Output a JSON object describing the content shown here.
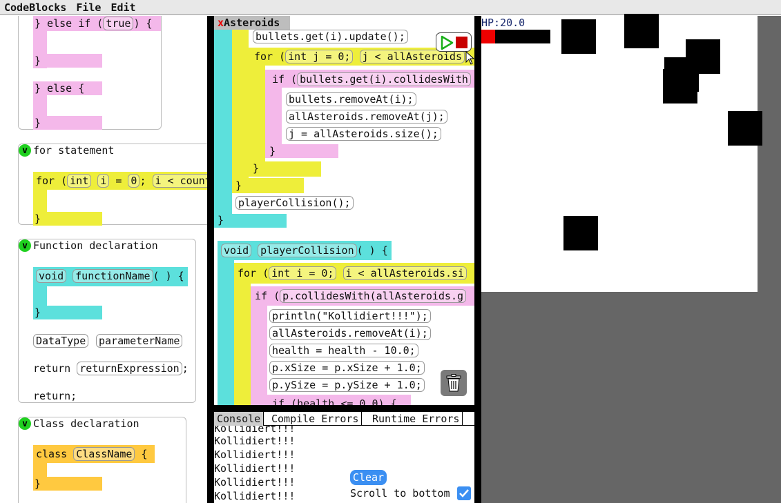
{
  "menubar": {
    "app": "CodeBlocks",
    "file": "File",
    "edit": "Edit"
  },
  "palette": {
    "elseif": {
      "keyword": "} else if (",
      "cond": "true",
      "tail": ") {",
      "close": "}"
    },
    "else": {
      "text": "} else {",
      "close": "}"
    },
    "for": {
      "title": "for statement",
      "kw": "for (",
      "int": "int",
      "var": "i",
      "eq": "= ",
      "zero": "0",
      "semi": ";",
      "cond": "i < count",
      "close": "}"
    },
    "func": {
      "title": "Function declaration",
      "void": "void",
      "name": "functionName",
      "paren": "( ) {",
      "close": "}",
      "datatype": "DataType",
      "param": "parameterName",
      "return_kw": "return",
      "return_expr": "returnExpression",
      "return_semi": ";",
      "return_only": "return;"
    },
    "class": {
      "title": "Class declaration",
      "kw": "class",
      "name": "ClassName",
      "brace": "{",
      "close": "}"
    },
    "v": "v"
  },
  "editor": {
    "tab_close": "x",
    "tab_title": "Asteroids",
    "lines": {
      "l1": "bullets.get(i).update();",
      "l2_kw": "for (",
      "l2_int": "int j = 0;",
      "l2_cond": "j < allAsteroids",
      "l3_kw": "if (",
      "l3_cond": "bullets.get(i).collidesWith",
      "l4": "bullets.removeAt(i);",
      "l5": "allAsteroids.removeAt(j);",
      "l6": "j = allAsteroids.size();",
      "c1": "}",
      "c2": "}",
      "c3": "}",
      "l7": "playerCollision();",
      "c4": "}",
      "f_void": "void",
      "f_name": "playerCollision",
      "f_paren": "( ) {",
      "f2_kw": "for (",
      "f2_int": "int i = 0;",
      "f2_cond": "i < allAsteroids.si",
      "f3_kw": "if (",
      "f3_cond": "p.collidesWith(allAsteroids.g",
      "f4": "println(\"Kollidiert!!!\");",
      "f5": "allAsteroids.removeAt(i);",
      "f6": "health = health - 10.0;",
      "f7": "p.xSize = p.xSize + 1.0;",
      "f8": "p.ySize = p.ySize + 1.0;",
      "f9": "if (health <= 0.0) {"
    }
  },
  "console": {
    "tabs": [
      "Console",
      "Compile Errors",
      "Runtime Errors"
    ],
    "lines": [
      "Kollidiert!!!",
      "Kollidiert!!!",
      "Kollidiert!!!",
      "Kollidiert!!!",
      "Kollidiert!!!",
      "Kollidiert!!!"
    ],
    "clear": "Clear",
    "scroll": "Scroll to bottom",
    "scroll_checked": true
  },
  "game": {
    "hp": "HP:20.0",
    "health_fraction": 0.2
  }
}
